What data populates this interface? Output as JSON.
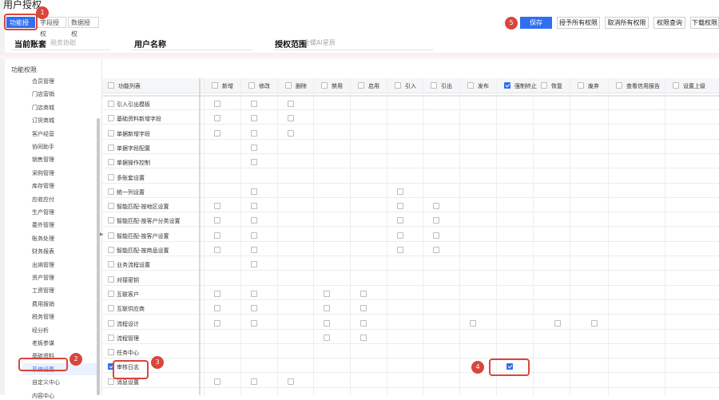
{
  "page": {
    "title": "用户授权"
  },
  "tabs": [
    {
      "label": "功能授权",
      "active": true
    },
    {
      "label": "字段授权"
    },
    {
      "label": "数据授权"
    }
  ],
  "toolbar": {
    "save": "保存",
    "grant_all": "授予所有权限",
    "revoke_all": "取消所有权限",
    "query": "权限查询",
    "download": "下载权限"
  },
  "info": {
    "account_label": "当前账套",
    "account_value": "税务协助",
    "username_label": "用户名称",
    "username_value": "",
    "scope_label": "授权范围",
    "scope_value": "全螺AI星辰"
  },
  "left": {
    "title": "功能权限",
    "items": [
      "合员管理",
      "门店营销",
      "门店商城",
      "订货商城",
      "客户经营",
      "协同助手",
      "销售管理",
      "采购管理",
      "库存管理",
      "应收应付",
      "生产管理",
      "委外管理",
      "账务处理",
      "财务报表",
      "出纳管理",
      "资产管理",
      "工资管理",
      "费用报销",
      "税务管理",
      "经分析",
      "老板参谋",
      "基础资料",
      "系统设置",
      "自定义中心",
      "内容中心"
    ],
    "selected": "系统设置"
  },
  "columns": [
    "功能列表",
    "新增",
    "修改",
    "删除",
    "禁用",
    "启用",
    "引入",
    "引出",
    "发布",
    "强制终止",
    "恢复",
    "废弃",
    "查看信用报告",
    "设置上级"
  ],
  "header_checked": {
    "强制终止": true
  },
  "rows": [
    {
      "label": "引入引出模板",
      "cbs": [
        0,
        1,
        2
      ]
    },
    {
      "label": "基础资料新增字段",
      "cbs": [
        0,
        1,
        2
      ]
    },
    {
      "label": "单据新增字段",
      "cbs": [
        0,
        1,
        2
      ]
    },
    {
      "label": "单据字段配置",
      "cbs": [
        1
      ]
    },
    {
      "label": "单据操作控制",
      "cbs": [
        1
      ]
    },
    {
      "label": "多账套设置",
      "cbs": []
    },
    {
      "label": "统一列设置",
      "cbs": [
        1,
        5
      ]
    },
    {
      "label": "智能匹配-按地区设置",
      "cbs": [
        0,
        1,
        5,
        6
      ]
    },
    {
      "label": "智能匹配-按客户分类设置",
      "cbs": [
        0,
        1,
        5,
        6
      ]
    },
    {
      "label": "智能匹配-按客户设置",
      "cbs": [
        0,
        1,
        5,
        6
      ]
    },
    {
      "label": "智能匹配-按商品设置",
      "cbs": [
        0,
        1,
        5,
        6
      ]
    },
    {
      "label": "业务流程设置",
      "cbs": [
        1
      ]
    },
    {
      "label": "对接密钥",
      "cbs": []
    },
    {
      "label": "互联客户",
      "cbs": [
        0,
        1,
        3,
        4
      ]
    },
    {
      "label": "互联供应商",
      "cbs": [
        0,
        1,
        3,
        4
      ]
    },
    {
      "label": "流程设计",
      "cbs": [
        0,
        1,
        3,
        4,
        7,
        9,
        10
      ]
    },
    {
      "label": "流程管理",
      "cbs": [
        3,
        4
      ]
    },
    {
      "label": "任务中心",
      "cbs": []
    },
    {
      "label": "审核日志",
      "cbs": [
        8
      ],
      "checked": true,
      "row_checked": true
    },
    {
      "label": "消息设置",
      "cbs": [
        0,
        1,
        2
      ]
    }
  ],
  "annotations": [
    "1",
    "2",
    "3",
    "4",
    "5"
  ],
  "colors": {
    "primary": "#2f6ff0",
    "annotation": "#d9463b"
  }
}
